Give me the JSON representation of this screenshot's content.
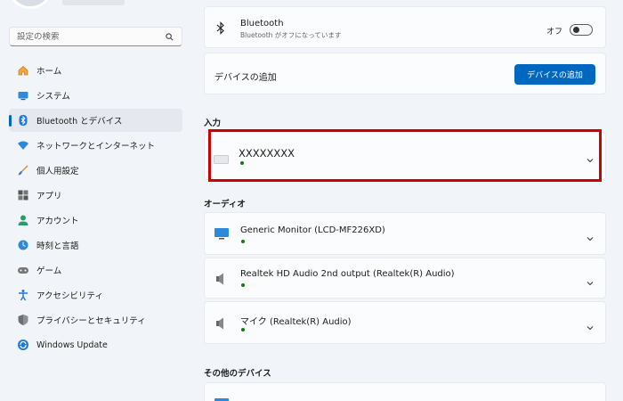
{
  "search": {
    "placeholder": "設定の検索"
  },
  "sidebar": {
    "items": [
      {
        "label": "ホーム",
        "icon": "home-icon",
        "active": false
      },
      {
        "label": "システム",
        "icon": "system-icon",
        "active": false
      },
      {
        "label": "Bluetooth とデバイス",
        "icon": "bluetooth-icon",
        "active": true
      },
      {
        "label": "ネットワークとインターネット",
        "icon": "network-icon",
        "active": false
      },
      {
        "label": "個人用設定",
        "icon": "personalization-icon",
        "active": false
      },
      {
        "label": "アプリ",
        "icon": "apps-icon",
        "active": false
      },
      {
        "label": "アカウント",
        "icon": "account-icon",
        "active": false
      },
      {
        "label": "時刻と言語",
        "icon": "time-language-icon",
        "active": false
      },
      {
        "label": "ゲーム",
        "icon": "gaming-icon",
        "active": false
      },
      {
        "label": "アクセシビリティ",
        "icon": "accessibility-icon",
        "active": false
      },
      {
        "label": "プライバシーとセキュリティ",
        "icon": "shield-icon",
        "active": false
      },
      {
        "label": "Windows Update",
        "icon": "windows-update-icon",
        "active": false
      }
    ]
  },
  "bluetooth": {
    "title": "Bluetooth",
    "subtitle": "Bluetooth がオフになっています",
    "toggle_label": "オフ",
    "toggle_on": false
  },
  "add_device": {
    "label": "デバイスの追加",
    "button_label": "デバイスの追加"
  },
  "input_section": {
    "label": "入力",
    "devices": [
      {
        "name": "XXXXXXXX",
        "icon": "keyboard-icon",
        "connected": true
      }
    ]
  },
  "audio_section": {
    "label": "オーディオ",
    "devices": [
      {
        "name": "Generic Monitor (LCD-MF226XD)",
        "icon": "monitor-icon",
        "connected": true
      },
      {
        "name": "Realtek HD Audio 2nd output (Realtek(R) Audio)",
        "icon": "speaker-icon",
        "connected": true
      },
      {
        "name": "マイク (Realtek(R) Audio)",
        "icon": "speaker-icon",
        "connected": true
      }
    ]
  },
  "other_section": {
    "label": "その他のデバイス"
  },
  "colors": {
    "accent": "#0067c0",
    "highlight": "#cc0000",
    "status_green": "#107c10"
  }
}
